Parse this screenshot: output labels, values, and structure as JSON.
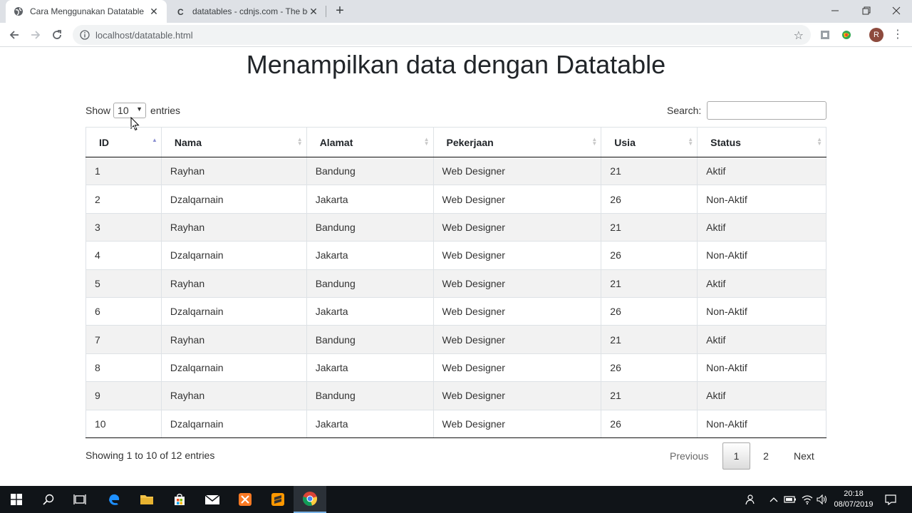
{
  "browser": {
    "tabs": [
      {
        "title": "Cara Menggunakan Datatable",
        "active": true
      },
      {
        "title": "datatables - cdnjs.com - The bes",
        "active": false
      }
    ],
    "address": "localhost/datatable.html",
    "profile_initial": "R"
  },
  "page": {
    "title": "Menampilkan data dengan Datatable",
    "length": {
      "label_before": "Show",
      "selected": "10",
      "label_after": "entries"
    },
    "search": {
      "label": "Search:",
      "value": ""
    },
    "table": {
      "columns": [
        "ID",
        "Nama",
        "Alamat",
        "Pekerjaan",
        "Usia",
        "Status"
      ],
      "sorted_column": "ID",
      "sort_direction": "ascending",
      "rows": [
        [
          "1",
          "Rayhan",
          "Bandung",
          "Web Designer",
          "21",
          "Aktif"
        ],
        [
          "2",
          "Dzalqarnain",
          "Jakarta",
          "Web Designer",
          "26",
          "Non-Aktif"
        ],
        [
          "3",
          "Rayhan",
          "Bandung",
          "Web Designer",
          "21",
          "Aktif"
        ],
        [
          "4",
          "Dzalqarnain",
          "Jakarta",
          "Web Designer",
          "26",
          "Non-Aktif"
        ],
        [
          "5",
          "Rayhan",
          "Bandung",
          "Web Designer",
          "21",
          "Aktif"
        ],
        [
          "6",
          "Dzalqarnain",
          "Jakarta",
          "Web Designer",
          "26",
          "Non-Aktif"
        ],
        [
          "7",
          "Rayhan",
          "Bandung",
          "Web Designer",
          "21",
          "Aktif"
        ],
        [
          "8",
          "Dzalqarnain",
          "Jakarta",
          "Web Designer",
          "26",
          "Non-Aktif"
        ],
        [
          "9",
          "Rayhan",
          "Bandung",
          "Web Designer",
          "21",
          "Aktif"
        ],
        [
          "10",
          "Dzalqarnain",
          "Jakarta",
          "Web Designer",
          "26",
          "Non-Aktif"
        ]
      ]
    },
    "info": "Showing 1 to 10 of 12 entries",
    "pagination": {
      "previous": "Previous",
      "pages": [
        "1",
        "2"
      ],
      "current": "1",
      "next": "Next"
    }
  },
  "taskbar": {
    "time": "20:18",
    "date": "08/07/2019"
  },
  "colors": {
    "stripe": "#f2f2f2",
    "taskbar": "#101418",
    "sort_active": "#8a8fd1"
  }
}
